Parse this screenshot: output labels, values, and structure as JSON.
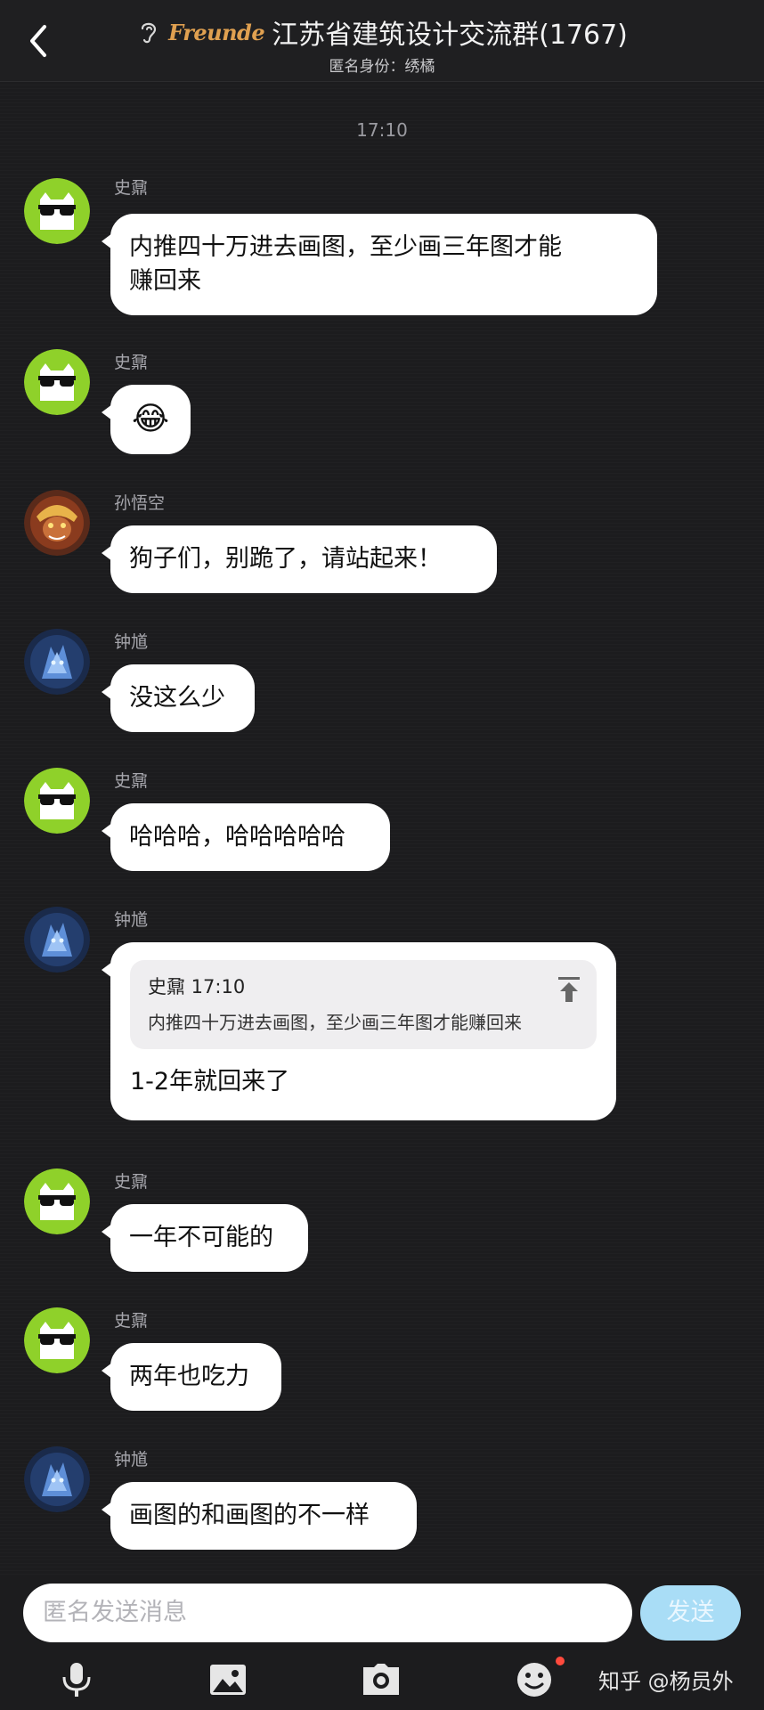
{
  "header": {
    "logo_text": "Freunde",
    "title": "江苏省建筑设计交流群(1767)",
    "subtitle": "匿名身份：绣橘"
  },
  "time_stamp": "17:10",
  "messages": [
    {
      "sender": "史鼐",
      "avatar": "sunglasses-cat",
      "text": "内推四十万进去画图，至少画三年图才能\n赚回来"
    },
    {
      "sender": "史鼐",
      "avatar": "sunglasses-cat",
      "text": "😂"
    },
    {
      "sender": "孙悟空",
      "avatar": "monkey-king",
      "text": "狗子们，别跪了，请站起来！"
    },
    {
      "sender": "钟馗",
      "avatar": "zhong-kui",
      "text": "没这么少"
    },
    {
      "sender": "史鼐",
      "avatar": "sunglasses-cat",
      "text": "哈哈哈，哈哈哈哈哈"
    },
    {
      "sender": "钟馗",
      "avatar": "zhong-kui",
      "quote": {
        "author_time": "史鼐 17:10",
        "text": "内推四十万进去画图，至少画三年图才能赚回来"
      },
      "text": "1-2年就回来了"
    },
    {
      "sender": "史鼐",
      "avatar": "sunglasses-cat",
      "text": "一年不可能的"
    },
    {
      "sender": "史鼐",
      "avatar": "sunglasses-cat",
      "text": "两年也吃力"
    },
    {
      "sender": "钟馗",
      "avatar": "zhong-kui",
      "text": "画图的和画图的不一样"
    }
  ],
  "composer": {
    "placeholder": "匿名发送消息",
    "send_label": "发送",
    "toolbar_icons": [
      "microphone-icon",
      "image-icon",
      "camera-icon",
      "emoji-icon"
    ]
  },
  "watermark": "知乎 @杨员外",
  "colors": {
    "background": "#1c1c1e",
    "bubble": "#ffffff",
    "avatar_green": "#8fd12a",
    "send_button": "#a9ddf6",
    "notification_dot": "#ff4a3d"
  }
}
